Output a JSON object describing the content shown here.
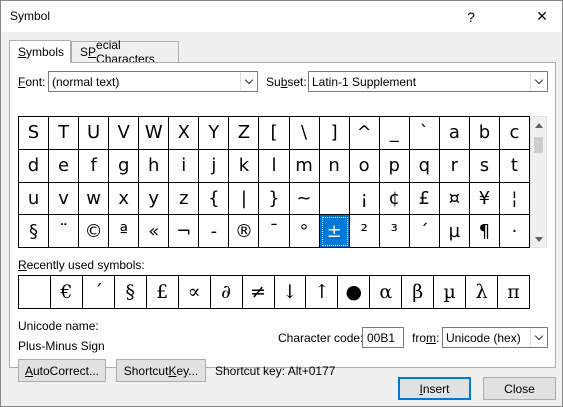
{
  "window": {
    "title": "Symbol",
    "help_glyph": "?",
    "close_glyph": "✕"
  },
  "tabs": [
    {
      "label": "Symbols",
      "accel": "S",
      "rest": "ymbols",
      "active": true
    },
    {
      "label": "Special Characters",
      "accel": "P",
      "pre": "S",
      "rest": "ecial Characters",
      "active": false
    }
  ],
  "font": {
    "label_accel": "F",
    "label_rest": "ont:",
    "value": "(normal text)"
  },
  "subset": {
    "label_pre": "Su",
    "label_accel": "b",
    "label_rest": "set:",
    "value": "Latin-1 Supplement"
  },
  "symbols": [
    [
      "S",
      "T",
      "U",
      "V",
      "W",
      "X",
      "Y",
      "Z",
      "[",
      "\\",
      "]",
      "^",
      "_",
      "`",
      "a",
      "b",
      "c"
    ],
    [
      "d",
      "e",
      "f",
      "g",
      "h",
      "i",
      "j",
      "k",
      "l",
      "m",
      "n",
      "o",
      "p",
      "q",
      "r",
      "s",
      "t"
    ],
    [
      "u",
      "v",
      "w",
      "x",
      "y",
      "z",
      "{",
      "|",
      "}",
      "~",
      "",
      "¡",
      "¢",
      "£",
      "¤",
      "¥",
      "¦"
    ],
    [
      "§",
      "¨",
      "©",
      "ª",
      "«",
      "¬",
      "-",
      "®",
      "¯",
      "°",
      "±",
      "²",
      "³",
      "´",
      "µ",
      "¶",
      "·"
    ]
  ],
  "selected_symbol": "±",
  "recent": {
    "label": "Recently used symbols:",
    "label_pre": "",
    "label_accel": "R",
    "label_rest": "ecently used symbols:",
    "symbols": [
      "",
      "€",
      "´",
      "§",
      "£",
      "∝",
      "∂",
      "≠",
      "↓",
      "↑",
      "●",
      "α",
      "β",
      "µ",
      "λ",
      "π",
      "∞"
    ]
  },
  "unicode": {
    "name_label": "Unicode name:",
    "name_value": "Plus-Minus Sign"
  },
  "char_code": {
    "label_pre": "Character code:",
    "value": "00B1",
    "from_label_pre": "fro",
    "from_label_accel": "m",
    "from_label_rest": ":",
    "from_value": "Unicode (hex)"
  },
  "buttons": {
    "autocorrect_accel": "A",
    "autocorrect_rest": "utoCorrect...",
    "shortcut_pre": "Shortcut ",
    "shortcut_accel": "K",
    "shortcut_rest": "ey...",
    "shortcut_text": "Shortcut key: Alt+0177",
    "insert_accel": "I",
    "insert_rest": "nsert",
    "close": "Close"
  },
  "colors": {
    "selection": "#0078d7",
    "dialog_bg": "#f0f0f0"
  }
}
